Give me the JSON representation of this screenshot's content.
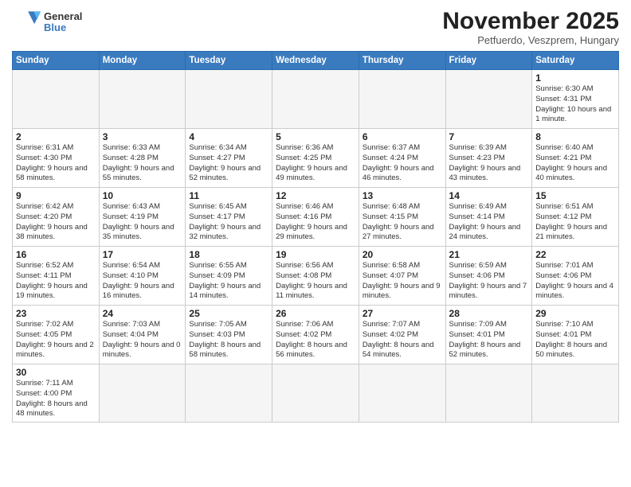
{
  "header": {
    "logo_general": "General",
    "logo_blue": "Blue",
    "month_title": "November 2025",
    "location": "Petfuerdo, Veszprem, Hungary"
  },
  "weekdays": [
    "Sunday",
    "Monday",
    "Tuesday",
    "Wednesday",
    "Thursday",
    "Friday",
    "Saturday"
  ],
  "weeks": [
    [
      {
        "day": null,
        "info": null
      },
      {
        "day": null,
        "info": null
      },
      {
        "day": null,
        "info": null
      },
      {
        "day": null,
        "info": null
      },
      {
        "day": null,
        "info": null
      },
      {
        "day": null,
        "info": null
      },
      {
        "day": "1",
        "info": "Sunrise: 6:30 AM\nSunset: 4:31 PM\nDaylight: 10 hours and 1 minute."
      }
    ],
    [
      {
        "day": "2",
        "info": "Sunrise: 6:31 AM\nSunset: 4:30 PM\nDaylight: 9 hours and 58 minutes."
      },
      {
        "day": "3",
        "info": "Sunrise: 6:33 AM\nSunset: 4:28 PM\nDaylight: 9 hours and 55 minutes."
      },
      {
        "day": "4",
        "info": "Sunrise: 6:34 AM\nSunset: 4:27 PM\nDaylight: 9 hours and 52 minutes."
      },
      {
        "day": "5",
        "info": "Sunrise: 6:36 AM\nSunset: 4:25 PM\nDaylight: 9 hours and 49 minutes."
      },
      {
        "day": "6",
        "info": "Sunrise: 6:37 AM\nSunset: 4:24 PM\nDaylight: 9 hours and 46 minutes."
      },
      {
        "day": "7",
        "info": "Sunrise: 6:39 AM\nSunset: 4:23 PM\nDaylight: 9 hours and 43 minutes."
      },
      {
        "day": "8",
        "info": "Sunrise: 6:40 AM\nSunset: 4:21 PM\nDaylight: 9 hours and 40 minutes."
      }
    ],
    [
      {
        "day": "9",
        "info": "Sunrise: 6:42 AM\nSunset: 4:20 PM\nDaylight: 9 hours and 38 minutes."
      },
      {
        "day": "10",
        "info": "Sunrise: 6:43 AM\nSunset: 4:19 PM\nDaylight: 9 hours and 35 minutes."
      },
      {
        "day": "11",
        "info": "Sunrise: 6:45 AM\nSunset: 4:17 PM\nDaylight: 9 hours and 32 minutes."
      },
      {
        "day": "12",
        "info": "Sunrise: 6:46 AM\nSunset: 4:16 PM\nDaylight: 9 hours and 29 minutes."
      },
      {
        "day": "13",
        "info": "Sunrise: 6:48 AM\nSunset: 4:15 PM\nDaylight: 9 hours and 27 minutes."
      },
      {
        "day": "14",
        "info": "Sunrise: 6:49 AM\nSunset: 4:14 PM\nDaylight: 9 hours and 24 minutes."
      },
      {
        "day": "15",
        "info": "Sunrise: 6:51 AM\nSunset: 4:12 PM\nDaylight: 9 hours and 21 minutes."
      }
    ],
    [
      {
        "day": "16",
        "info": "Sunrise: 6:52 AM\nSunset: 4:11 PM\nDaylight: 9 hours and 19 minutes."
      },
      {
        "day": "17",
        "info": "Sunrise: 6:54 AM\nSunset: 4:10 PM\nDaylight: 9 hours and 16 minutes."
      },
      {
        "day": "18",
        "info": "Sunrise: 6:55 AM\nSunset: 4:09 PM\nDaylight: 9 hours and 14 minutes."
      },
      {
        "day": "19",
        "info": "Sunrise: 6:56 AM\nSunset: 4:08 PM\nDaylight: 9 hours and 11 minutes."
      },
      {
        "day": "20",
        "info": "Sunrise: 6:58 AM\nSunset: 4:07 PM\nDaylight: 9 hours and 9 minutes."
      },
      {
        "day": "21",
        "info": "Sunrise: 6:59 AM\nSunset: 4:06 PM\nDaylight: 9 hours and 7 minutes."
      },
      {
        "day": "22",
        "info": "Sunrise: 7:01 AM\nSunset: 4:06 PM\nDaylight: 9 hours and 4 minutes."
      }
    ],
    [
      {
        "day": "23",
        "info": "Sunrise: 7:02 AM\nSunset: 4:05 PM\nDaylight: 9 hours and 2 minutes."
      },
      {
        "day": "24",
        "info": "Sunrise: 7:03 AM\nSunset: 4:04 PM\nDaylight: 9 hours and 0 minutes."
      },
      {
        "day": "25",
        "info": "Sunrise: 7:05 AM\nSunset: 4:03 PM\nDaylight: 8 hours and 58 minutes."
      },
      {
        "day": "26",
        "info": "Sunrise: 7:06 AM\nSunset: 4:02 PM\nDaylight: 8 hours and 56 minutes."
      },
      {
        "day": "27",
        "info": "Sunrise: 7:07 AM\nSunset: 4:02 PM\nDaylight: 8 hours and 54 minutes."
      },
      {
        "day": "28",
        "info": "Sunrise: 7:09 AM\nSunset: 4:01 PM\nDaylight: 8 hours and 52 minutes."
      },
      {
        "day": "29",
        "info": "Sunrise: 7:10 AM\nSunset: 4:01 PM\nDaylight: 8 hours and 50 minutes."
      }
    ],
    [
      {
        "day": "30",
        "info": "Sunrise: 7:11 AM\nSunset: 4:00 PM\nDaylight: 8 hours and 48 minutes."
      },
      {
        "day": null,
        "info": null
      },
      {
        "day": null,
        "info": null
      },
      {
        "day": null,
        "info": null
      },
      {
        "day": null,
        "info": null
      },
      {
        "day": null,
        "info": null
      },
      {
        "day": null,
        "info": null
      }
    ]
  ]
}
